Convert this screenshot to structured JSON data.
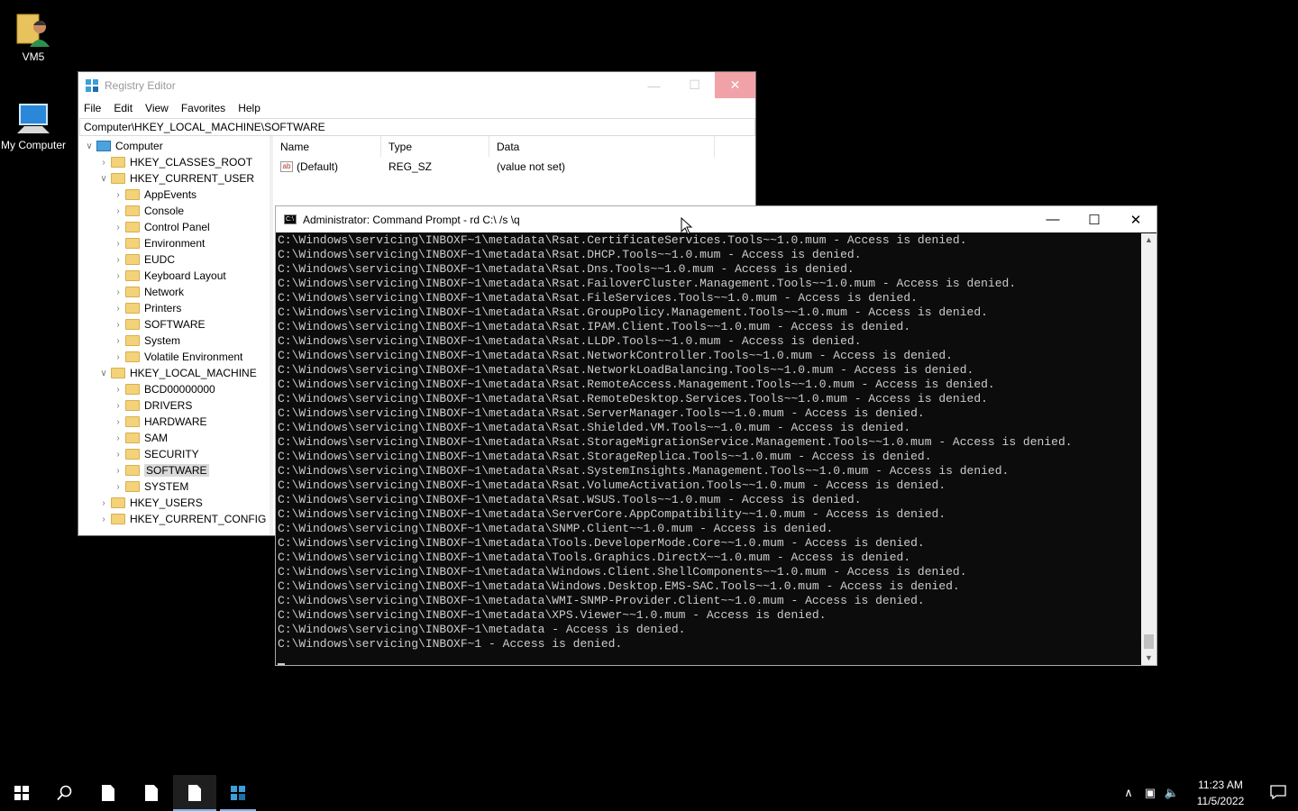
{
  "desktop": {
    "icons": [
      {
        "label": "VM5"
      },
      {
        "label": "My Computer"
      }
    ]
  },
  "regedit": {
    "title": "Registry Editor",
    "menu": [
      "File",
      "Edit",
      "View",
      "Favorites",
      "Help"
    ],
    "address": "Computer\\HKEY_LOCAL_MACHINE\\SOFTWARE",
    "tree": {
      "root": "Computer",
      "hkcr": "HKEY_CLASSES_ROOT",
      "hkcu": "HKEY_CURRENT_USER",
      "hkcu_children": [
        "AppEvents",
        "Console",
        "Control Panel",
        "Environment",
        "EUDC",
        "Keyboard Layout",
        "Network",
        "Printers",
        "SOFTWARE",
        "System",
        "Volatile Environment"
      ],
      "hklm": "HKEY_LOCAL_MACHINE",
      "hklm_children": [
        "BCD00000000",
        "DRIVERS",
        "HARDWARE",
        "SAM",
        "SECURITY",
        "SOFTWARE",
        "SYSTEM"
      ],
      "hku": "HKEY_USERS",
      "hkcc": "HKEY_CURRENT_CONFIG"
    },
    "columns": {
      "name": "Name",
      "type": "Type",
      "data": "Data"
    },
    "values": [
      {
        "name": "(Default)",
        "type": "REG_SZ",
        "data": "(value not set)"
      }
    ]
  },
  "cmd": {
    "title": "Administrator: Command Prompt - rd  C:\\ /s \\q",
    "lines": [
      "C:\\Windows\\servicing\\INBOXF~1\\metadata\\Rsat.CertificateServices.Tools~~1.0.mum - Access is denied.",
      "C:\\Windows\\servicing\\INBOXF~1\\metadata\\Rsat.DHCP.Tools~~1.0.mum - Access is denied.",
      "C:\\Windows\\servicing\\INBOXF~1\\metadata\\Rsat.Dns.Tools~~1.0.mum - Access is denied.",
      "C:\\Windows\\servicing\\INBOXF~1\\metadata\\Rsat.FailoverCluster.Management.Tools~~1.0.mum - Access is denied.",
      "C:\\Windows\\servicing\\INBOXF~1\\metadata\\Rsat.FileServices.Tools~~1.0.mum - Access is denied.",
      "C:\\Windows\\servicing\\INBOXF~1\\metadata\\Rsat.GroupPolicy.Management.Tools~~1.0.mum - Access is denied.",
      "C:\\Windows\\servicing\\INBOXF~1\\metadata\\Rsat.IPAM.Client.Tools~~1.0.mum - Access is denied.",
      "C:\\Windows\\servicing\\INBOXF~1\\metadata\\Rsat.LLDP.Tools~~1.0.mum - Access is denied.",
      "C:\\Windows\\servicing\\INBOXF~1\\metadata\\Rsat.NetworkController.Tools~~1.0.mum - Access is denied.",
      "C:\\Windows\\servicing\\INBOXF~1\\metadata\\Rsat.NetworkLoadBalancing.Tools~~1.0.mum - Access is denied.",
      "C:\\Windows\\servicing\\INBOXF~1\\metadata\\Rsat.RemoteAccess.Management.Tools~~1.0.mum - Access is denied.",
      "C:\\Windows\\servicing\\INBOXF~1\\metadata\\Rsat.RemoteDesktop.Services.Tools~~1.0.mum - Access is denied.",
      "C:\\Windows\\servicing\\INBOXF~1\\metadata\\Rsat.ServerManager.Tools~~1.0.mum - Access is denied.",
      "C:\\Windows\\servicing\\INBOXF~1\\metadata\\Rsat.Shielded.VM.Tools~~1.0.mum - Access is denied.",
      "C:\\Windows\\servicing\\INBOXF~1\\metadata\\Rsat.StorageMigrationService.Management.Tools~~1.0.mum - Access is denied.",
      "C:\\Windows\\servicing\\INBOXF~1\\metadata\\Rsat.StorageReplica.Tools~~1.0.mum - Access is denied.",
      "C:\\Windows\\servicing\\INBOXF~1\\metadata\\Rsat.SystemInsights.Management.Tools~~1.0.mum - Access is denied.",
      "C:\\Windows\\servicing\\INBOXF~1\\metadata\\Rsat.VolumeActivation.Tools~~1.0.mum - Access is denied.",
      "C:\\Windows\\servicing\\INBOXF~1\\metadata\\Rsat.WSUS.Tools~~1.0.mum - Access is denied.",
      "C:\\Windows\\servicing\\INBOXF~1\\metadata\\ServerCore.AppCompatibility~~1.0.mum - Access is denied.",
      "C:\\Windows\\servicing\\INBOXF~1\\metadata\\SNMP.Client~~1.0.mum - Access is denied.",
      "C:\\Windows\\servicing\\INBOXF~1\\metadata\\Tools.DeveloperMode.Core~~1.0.mum - Access is denied.",
      "C:\\Windows\\servicing\\INBOXF~1\\metadata\\Tools.Graphics.DirectX~~1.0.mum - Access is denied.",
      "C:\\Windows\\servicing\\INBOXF~1\\metadata\\Windows.Client.ShellComponents~~1.0.mum - Access is denied.",
      "C:\\Windows\\servicing\\INBOXF~1\\metadata\\Windows.Desktop.EMS-SAC.Tools~~1.0.mum - Access is denied.",
      "C:\\Windows\\servicing\\INBOXF~1\\metadata\\WMI-SNMP-Provider.Client~~1.0.mum - Access is denied.",
      "C:\\Windows\\servicing\\INBOXF~1\\metadata\\XPS.Viewer~~1.0.mum - Access is denied.",
      "C:\\Windows\\servicing\\INBOXF~1\\metadata - Access is denied.",
      "C:\\Windows\\servicing\\INBOXF~1 - Access is denied."
    ]
  },
  "taskbar": {
    "time": "11:23 AM",
    "date": "11/5/2022",
    "icons": [
      "start-icon",
      "search-icon",
      "file-icon",
      "file-icon",
      "file-icon",
      "regedit-icon"
    ],
    "colors": {
      "active_underline": "#76b9ed"
    }
  }
}
